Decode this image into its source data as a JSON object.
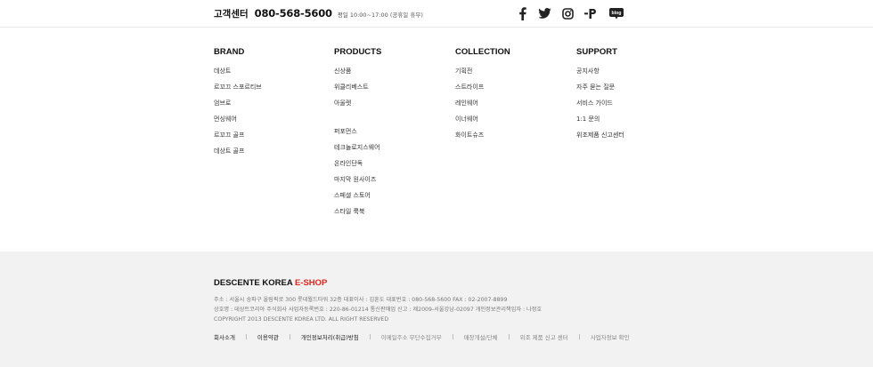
{
  "top_bar": {
    "cs_label": "고객센터",
    "cs_phone": "080-568-5600",
    "cs_hours": "평일 10:00~17:00 (공휴일 휴무)",
    "social": [
      {
        "name": "facebook-icon"
      },
      {
        "name": "twitter-icon"
      },
      {
        "name": "instagram-icon"
      },
      {
        "name": "post-icon",
        "label": "P"
      },
      {
        "name": "blog-icon",
        "label": "blog"
      }
    ]
  },
  "columns": [
    {
      "title": "BRAND",
      "groups": [
        [
          "데상트",
          "르꼬끄 스포르티브",
          "엄브로",
          "먼싱웨어",
          "르꼬끄 골프",
          "데상트 골프"
        ]
      ]
    },
    {
      "title": "PRODUCTS",
      "groups": [
        [
          "신상품",
          "위클리베스트",
          "아울렛"
        ],
        [
          "퍼포먼스",
          "테크놀로지스웨어",
          "온라인단독",
          "마지막 원사이즈",
          "스페셜 스토어",
          "스타일 룩북"
        ]
      ]
    },
    {
      "title": "COLLECTION",
      "groups": [
        [
          "기획전",
          "스트라이프",
          "레인웨어",
          "이너웨어",
          "화이트슈즈"
        ]
      ]
    },
    {
      "title": "SUPPORT",
      "groups": [
        [
          "공지사항",
          "자주 묻는 질문",
          "서비스 가이드",
          "1:1 문의",
          "위조제품 신고센터"
        ]
      ]
    }
  ],
  "footer": {
    "brand_main": "DESCENTE KOREA ",
    "brand_accent": "E-SHOP",
    "info_lines": [
      "주소 : 서울시 송파구 올림픽로 300 롯데월드타워 32층    대표이사 : 김훈도    대표번호 : 080-568-5600    FAX : 02-2007-8899",
      "상호명 : 데상트코리아 주식회사    사업자등록번호 : 220-86-01214  통신판매업 신고 : 제2009-서울강남-02097    개인정보관리책임자 : 나정호",
      "COPYRIGHT 2013 DESCENTE KOREA LTD. ALL RIGHT RESERVED"
    ],
    "links": [
      {
        "label": "회사소개",
        "strong": true
      },
      {
        "label": "이용약관",
        "strong": true
      },
      {
        "label": "개인정보처리(취급)방침",
        "strong": true
      },
      {
        "label": "이메일주소 무단수집거부",
        "strong": false
      },
      {
        "label": "매장개설/단체",
        "strong": false
      },
      {
        "label": "위조 제품 신고 센터",
        "strong": false
      },
      {
        "label": "사업자정보 확인",
        "strong": false
      }
    ]
  },
  "colors": {
    "accent": "#e2231a",
    "footer_bg": "#f2f2f2",
    "text_dark": "#111111",
    "text_muted": "#777777"
  }
}
